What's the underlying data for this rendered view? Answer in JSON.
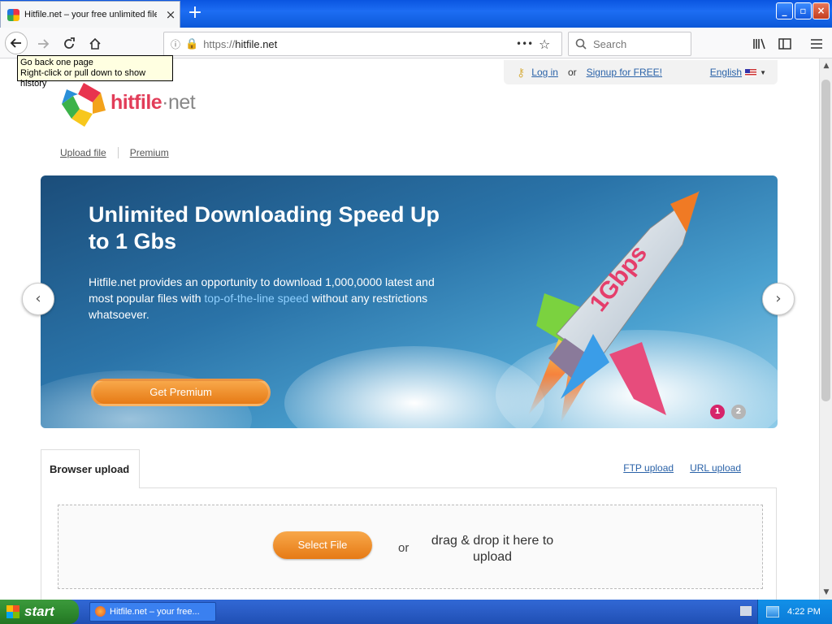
{
  "browser": {
    "tab_title": "Hitfile.net – your free unlimited file",
    "tab_close": "×",
    "new_tab": "+",
    "url_prefix": "https://",
    "url_domain": "hitfile.net",
    "page_actions": "•••",
    "search_placeholder": "Search",
    "tooltip_line1": "Go back one page",
    "tooltip_line2": "Right-click or pull down to show history"
  },
  "site": {
    "login": "Log in",
    "or": "or",
    "signup": "Signup for FREE!",
    "language": "English",
    "logo_main": "hitfile",
    "logo_suffix": "·net",
    "nav": [
      "Upload file",
      "Premium"
    ]
  },
  "banner": {
    "headline": "Unlimited Downloading Speed Up to 1 Gbs",
    "text_before": "Hitfile.net provides an opportunity to download 1,000,0000 latest and most popular files with ",
    "text_highlight": "top-of-the-line speed",
    "text_after": " without any restrictions whatsoever.",
    "cta": "Get Premium",
    "rocket_label": "1Gbps",
    "slides": [
      "1",
      "2"
    ],
    "active_slide": 1,
    "prev": "‹",
    "next": "›"
  },
  "upload": {
    "tab": "Browser upload",
    "ftp": "FTP upload",
    "url": "URL upload",
    "select": "Select File",
    "or": "or",
    "drag": "drag & drop it here to upload"
  },
  "taskbar": {
    "start": "start",
    "item": "Hitfile.net – your free...",
    "time": "4:22 PM"
  },
  "colors": {
    "accent_orange": "#e67a15",
    "link_blue": "#2a62a8",
    "xp_blue": "#2a5cc5",
    "logo_pink": "#e23d59"
  }
}
